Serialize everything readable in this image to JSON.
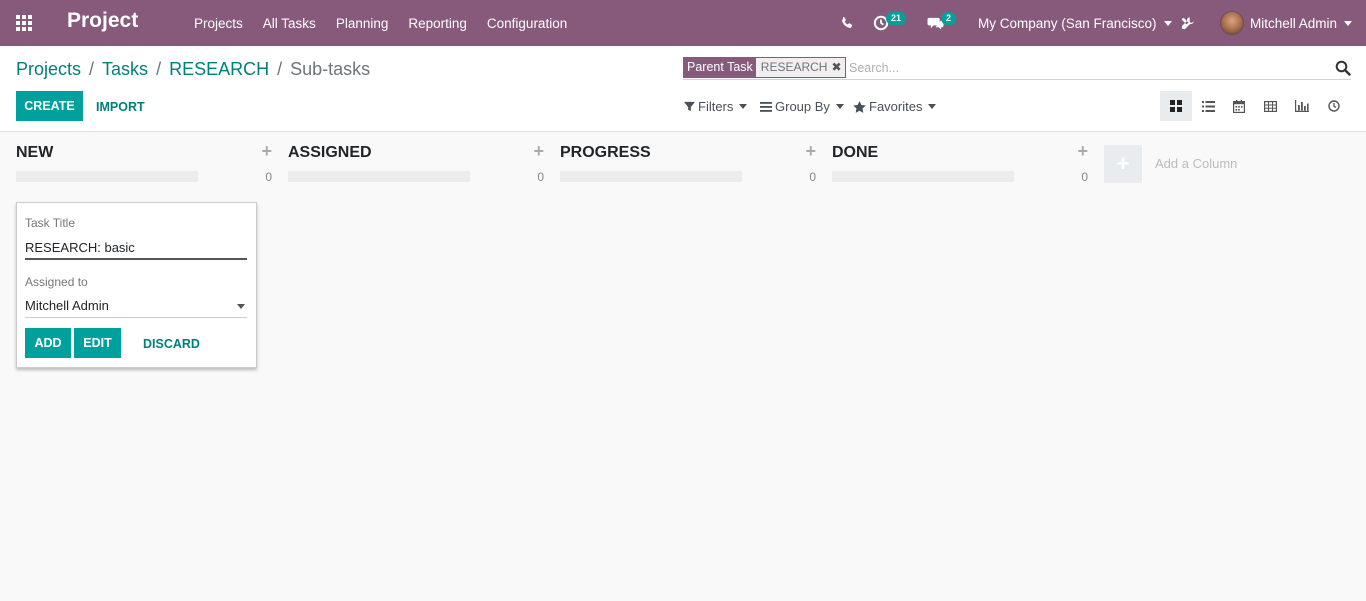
{
  "navbar": {
    "app_title": "Project",
    "menu": [
      "Projects",
      "All Tasks",
      "Planning",
      "Reporting",
      "Configuration"
    ],
    "activity_count": "21",
    "message_count": "2",
    "company": "My Company (San Francisco)",
    "user": "Mitchell Admin"
  },
  "breadcrumb": {
    "items": [
      "Projects",
      "Tasks",
      "RESEARCH"
    ],
    "separator": "/",
    "current": "Sub-tasks"
  },
  "buttons": {
    "create": "CREATE",
    "import": "IMPORT"
  },
  "search": {
    "facet_label": "Parent Task",
    "facet_value": "RESEARCH",
    "facet_remove": "✖",
    "placeholder": "Search..."
  },
  "filters": {
    "filters": "Filters",
    "group_by": "Group By",
    "favorites": "Favorites"
  },
  "views": [
    "kanban",
    "list",
    "calendar",
    "pivot",
    "graph",
    "activity"
  ],
  "active_view": "kanban",
  "columns": [
    {
      "title": "NEW",
      "count": "0"
    },
    {
      "title": "ASSIGNED",
      "count": "0"
    },
    {
      "title": "PROGRESS",
      "count": "0"
    },
    {
      "title": "DONE",
      "count": "0"
    }
  ],
  "column_add_symbol": "+",
  "add_column": {
    "symbol": "+",
    "label": "Add a Column"
  },
  "quick_create": {
    "title_label": "Task Title",
    "title_value": "RESEARCH: basic",
    "assigned_label": "Assigned to",
    "assigned_value": "Mitchell Admin",
    "add": "ADD",
    "edit": "EDIT",
    "discard": "DISCARD"
  },
  "colors": {
    "brand": "#875a7b",
    "primary": "#00a09d",
    "link": "#00807a"
  }
}
